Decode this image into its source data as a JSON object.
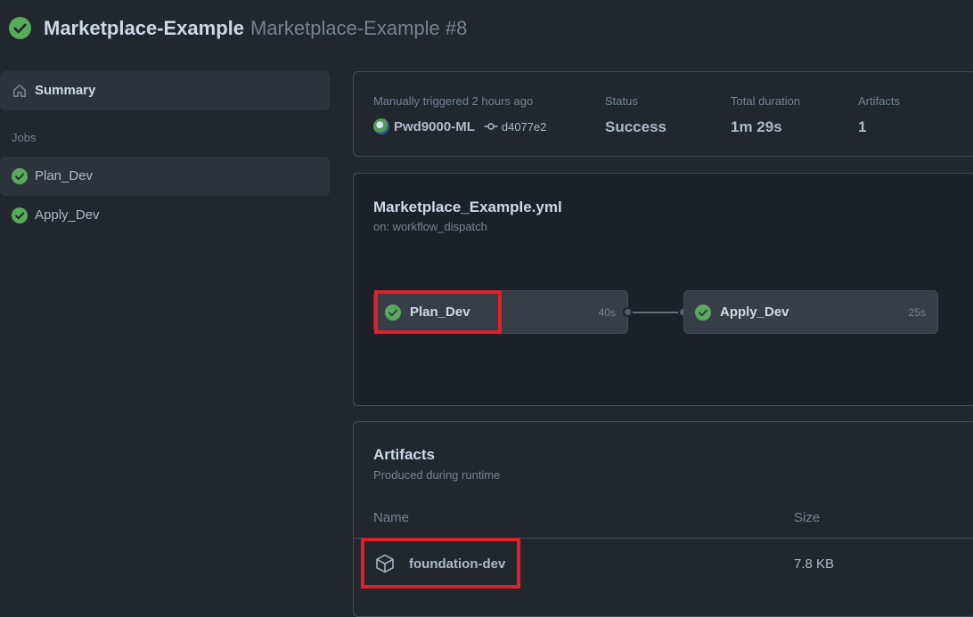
{
  "header": {
    "repo_name": "Marketplace-Example",
    "run_name": "Marketplace-Example #8",
    "status_icon": "check-circle-fill-icon"
  },
  "sidebar": {
    "summary_label": "Summary",
    "summary_icon": "home-icon",
    "jobs_heading": "Jobs",
    "jobs": [
      {
        "label": "Plan_Dev",
        "icon": "check-circle-fill-icon"
      },
      {
        "label": "Apply_Dev",
        "icon": "check-circle-fill-icon"
      }
    ]
  },
  "run_info": {
    "trigger_label": "Manually triggered 2 hours ago",
    "actor": "Pwd9000-ML",
    "commit": "d4077e2",
    "status_label": "Status",
    "status_value": "Success",
    "duration_label": "Total duration",
    "duration_value": "1m 29s",
    "artifacts_label": "Artifacts",
    "artifacts_value": "1"
  },
  "workflow": {
    "file": "Marketplace_Example.yml",
    "trigger": "on: workflow_dispatch",
    "jobs": [
      {
        "name": "Plan_Dev",
        "duration": "40s"
      },
      {
        "name": "Apply_Dev",
        "duration": "25s"
      }
    ]
  },
  "artifacts": {
    "title": "Artifacts",
    "subtitle": "Produced during runtime",
    "col_name": "Name",
    "col_size": "Size",
    "items": [
      {
        "name": "foundation-dev",
        "size": "7.8 KB",
        "icon": "package-icon"
      }
    ]
  },
  "colors": {
    "success": "#57ab5a",
    "highlight": "#e0202a",
    "background": "#22272e"
  }
}
